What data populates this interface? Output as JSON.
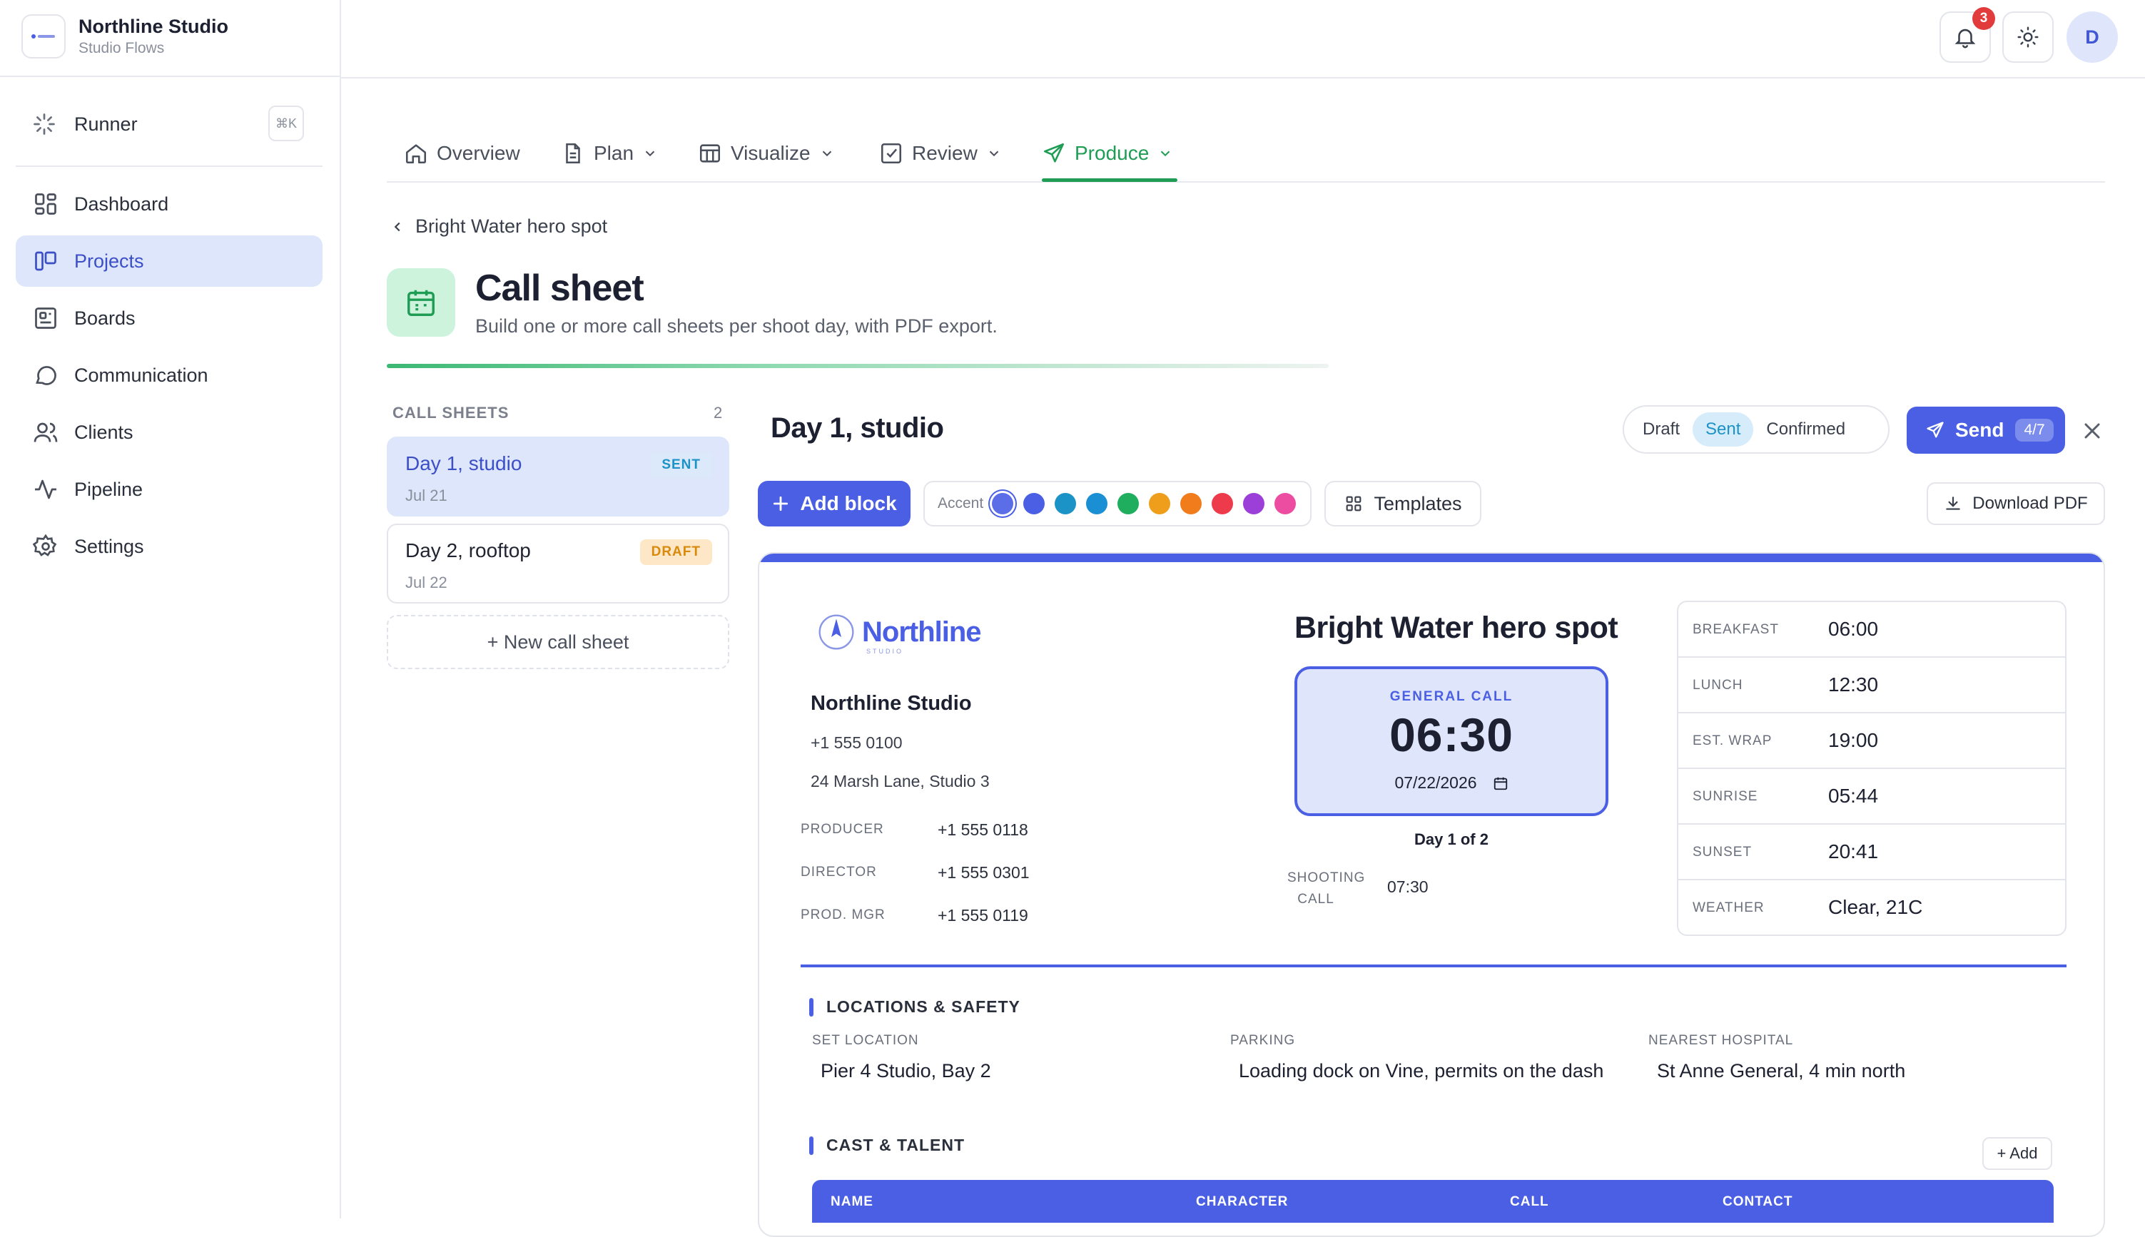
{
  "org": {
    "name": "Northline Studio",
    "subtitle": "Studio Flows"
  },
  "runner": {
    "label": "Runner",
    "shortcut": "⌘K"
  },
  "nav": [
    {
      "label": "Dashboard",
      "icon": "dashboard-icon"
    },
    {
      "label": "Projects",
      "icon": "projects-icon",
      "active": true
    },
    {
      "label": "Boards",
      "icon": "boards-icon"
    },
    {
      "label": "Communication",
      "icon": "chat-icon"
    },
    {
      "label": "Clients",
      "icon": "users-icon"
    },
    {
      "label": "Pipeline",
      "icon": "pulse-icon"
    },
    {
      "label": "Settings",
      "icon": "gear-icon"
    }
  ],
  "topbar": {
    "notifications": "3",
    "avatar": "D"
  },
  "tabs": [
    {
      "label": "Overview"
    },
    {
      "label": "Plan"
    },
    {
      "label": "Visualize"
    },
    {
      "label": "Review"
    },
    {
      "label": "Produce",
      "active": true
    }
  ],
  "breadcrumb": "Bright Water hero spot",
  "page": {
    "title": "Call sheet",
    "subtitle": "Build one or more call sheets per shoot day, with PDF export."
  },
  "call_sheets": {
    "heading": "CALL SHEETS",
    "count": "2",
    "items": [
      {
        "name": "Day 1, studio",
        "date": "Jul 21",
        "badge": "SENT"
      },
      {
        "name": "Day 2, rooftop",
        "date": "Jul 22",
        "badge": "DRAFT"
      }
    ],
    "new_label": "+ New call sheet"
  },
  "editor": {
    "title": "Day 1, studio",
    "status_options": [
      "Draft",
      "Sent",
      "Confirmed"
    ],
    "status_selected": "Sent",
    "send_label": "Send",
    "send_count": "4/7",
    "add_block": "Add block",
    "accent_label": "Accent",
    "accent_colors": [
      "#5b6ee8",
      "#4a5fe3",
      "#1b93c7",
      "#1b8fd4",
      "#1fae5e",
      "#ee9e1a",
      "#f07c1c",
      "#ee3b4b",
      "#9b3fd8",
      "#ec4da0"
    ],
    "templates_label": "Templates",
    "download_label": "Download PDF"
  },
  "doc": {
    "brand": "Northline",
    "brand_sub": "STUDIO",
    "company": "Northline Studio",
    "phone": "+1 555 0100",
    "address": "24 Marsh Lane, Studio 3",
    "contacts": [
      {
        "role": "PRODUCER",
        "phone": "+1 555 0118"
      },
      {
        "role": "DIRECTOR",
        "phone": "+1 555 0301"
      },
      {
        "role": "PROD. MGR",
        "phone": "+1 555 0119"
      }
    ],
    "project": "Bright Water hero spot",
    "general_call_label": "GENERAL CALL",
    "general_call": "06:30",
    "date": "07/22/2026",
    "day_of": "Day 1 of 2",
    "shooting_call_label": "SHOOTING CALL",
    "shooting_call": "07:30",
    "times": [
      {
        "label": "BREAKFAST",
        "value": "06:00"
      },
      {
        "label": "LUNCH",
        "value": "12:30"
      },
      {
        "label": "EST. WRAP",
        "value": "19:00"
      },
      {
        "label": "SUNRISE",
        "value": "05:44"
      },
      {
        "label": "SUNSET",
        "value": "20:41"
      },
      {
        "label": "WEATHER",
        "value": "Clear, 21C"
      }
    ],
    "locations": {
      "title": "LOCATIONS & SAFETY",
      "items": [
        {
          "label": "SET LOCATION",
          "value": "Pier 4 Studio, Bay 2"
        },
        {
          "label": "PARKING",
          "value": "Loading dock on Vine, permits on the dash"
        },
        {
          "label": "NEAREST HOSPITAL",
          "value": "St Anne General, 4 min north"
        }
      ]
    },
    "cast": {
      "title": "CAST & TALENT",
      "add_label": "+ Add",
      "columns": [
        "NAME",
        "CHARACTER",
        "CALL",
        "CONTACT"
      ]
    }
  }
}
